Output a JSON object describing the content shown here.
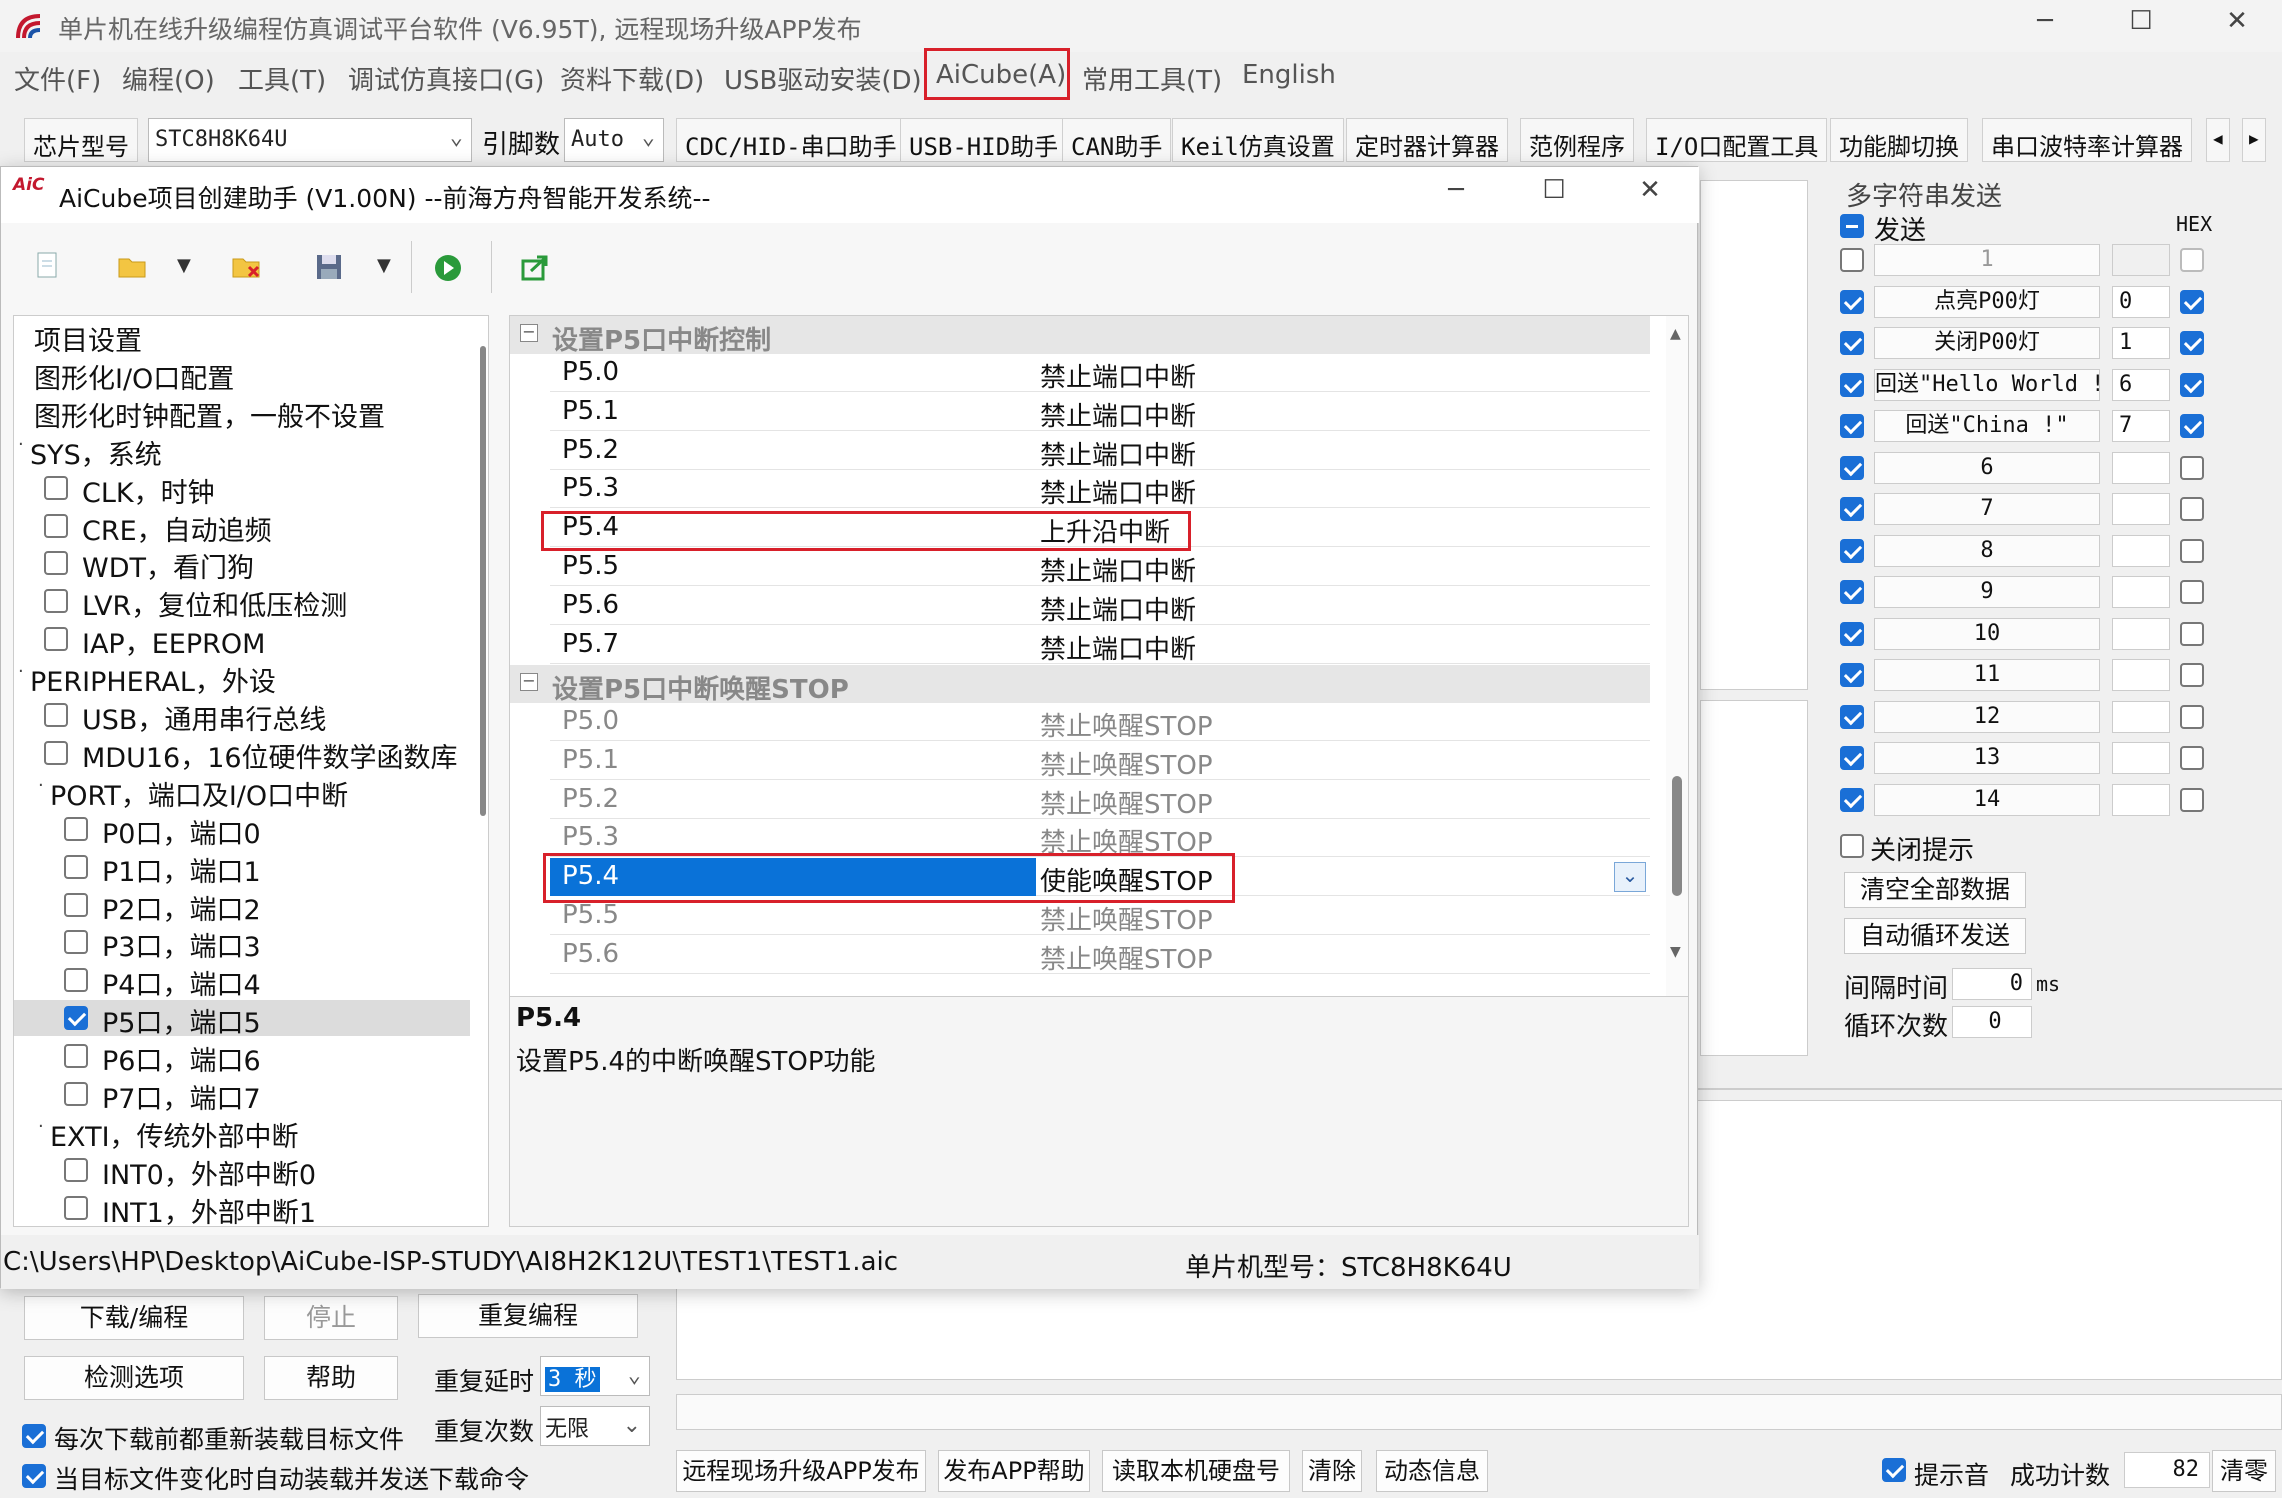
{
  "main_window": {
    "title": "单片机在线升级编程仿真调试平台软件 (V6.95T), 远程现场升级APP发布"
  },
  "menu": [
    "文件(F)",
    "编程(O)",
    "工具(T)",
    "调试仿真接口(G)",
    "资料下载(D)",
    "USB驱动安装(D)",
    "AiCube(A)",
    "常用工具(T)",
    "English"
  ],
  "toolbar": {
    "chip_label": "芯片型号",
    "chip_value": "STC8H8K64U",
    "pins_label": "引脚数",
    "pins_value": "Auto",
    "tabs": [
      "CDC/HID-串口助手",
      "USB-HID助手",
      "CAN助手",
      "Keil仿真设置",
      "定时器计算器",
      "范例程序",
      "I/O口配置工具",
      "功能脚切换",
      "串口波特率计算器"
    ],
    "scroll_left": "◀",
    "scroll_right": "▶"
  },
  "right_panel": {
    "group_title": "多字符串发送",
    "send_label": "发送",
    "hex_label": "HEX",
    "rows": [
      {
        "checked": false,
        "label": "1",
        "hex_value": "",
        "hex": false
      },
      {
        "checked": true,
        "label": "点亮P00灯",
        "hex_value": "0",
        "hex": true
      },
      {
        "checked": true,
        "label": "关闭P00灯",
        "hex_value": "1",
        "hex": true
      },
      {
        "checked": true,
        "label": "回送\"Hello World !\"",
        "hex_value": "6",
        "hex": true
      },
      {
        "checked": true,
        "label": "回送\"China !\"",
        "hex_value": "7",
        "hex": true
      },
      {
        "checked": true,
        "label": "6",
        "hex_value": "",
        "hex": false
      },
      {
        "checked": true,
        "label": "7",
        "hex_value": "",
        "hex": false
      },
      {
        "checked": true,
        "label": "8",
        "hex_value": "",
        "hex": false
      },
      {
        "checked": true,
        "label": "9",
        "hex_value": "",
        "hex": false
      },
      {
        "checked": true,
        "label": "10",
        "hex_value": "",
        "hex": false
      },
      {
        "checked": true,
        "label": "11",
        "hex_value": "",
        "hex": false
      },
      {
        "checked": true,
        "label": "12",
        "hex_value": "",
        "hex": false
      },
      {
        "checked": true,
        "label": "13",
        "hex_value": "",
        "hex": false
      },
      {
        "checked": true,
        "label": "14",
        "hex_value": "",
        "hex": false
      }
    ],
    "close_tip": "关闭提示",
    "clear_all": "清空全部数据",
    "auto_loop": "自动循环发送",
    "interval_label": "间隔时间",
    "interval_value": "0",
    "interval_unit": "ms",
    "loop_label": "循环次数",
    "loop_value": "0"
  },
  "bottom": {
    "download": "下载/编程",
    "stop": "停止",
    "reprogram": "重复编程",
    "detect": "检测选项",
    "help": "帮助",
    "repeat_delay_label": "重复延时",
    "repeat_delay_value": "3 秒",
    "repeat_count_label": "重复次数",
    "repeat_count_value": "无限",
    "reload_each": "每次下载前都重新装载目标文件",
    "reload_change": "当目标文件变化时自动装载并发送下载命令",
    "publish_app": "远程现场升级APP发布",
    "publish_help": "发布APP帮助",
    "read_disk": "读取本机硬盘号",
    "clear": "清除",
    "dynamic": "动态信息",
    "beep": "提示音",
    "success_label": "成功计数",
    "success_value": "82",
    "reset": "清零"
  },
  "dialog": {
    "title": "AiCube项目创建助手 (V1.00N) --前海方舟智能开发系统--",
    "logo_text": "AiC",
    "tree": [
      {
        "label": "项目设置",
        "level": 0,
        "check": null,
        "bullet": false
      },
      {
        "label": "图形化I/O口配置",
        "level": 0,
        "check": null,
        "bullet": false
      },
      {
        "label": "图形化时钟配置，一般不设置",
        "level": 0,
        "check": null,
        "bullet": false
      },
      {
        "label": "SYS，系统",
        "level": 0,
        "check": null,
        "bullet": true
      },
      {
        "label": "CLK，时钟",
        "level": 1,
        "check": false,
        "bullet": false
      },
      {
        "label": "CRE，自动追频",
        "level": 1,
        "check": false,
        "bullet": false
      },
      {
        "label": "WDT，看门狗",
        "level": 1,
        "check": false,
        "bullet": false
      },
      {
        "label": "LVR，复位和低压检测",
        "level": 1,
        "check": false,
        "bullet": false
      },
      {
        "label": "IAP，EEPROM",
        "level": 1,
        "check": false,
        "bullet": false
      },
      {
        "label": "PERIPHERAL，外设",
        "level": 0,
        "check": null,
        "bullet": true
      },
      {
        "label": "USB，通用串行总线",
        "level": 1,
        "check": false,
        "bullet": false
      },
      {
        "label": "MDU16，16位硬件数学函数库",
        "level": 1,
        "check": false,
        "bullet": false
      },
      {
        "label": "PORT，端口及I/O口中断",
        "level": 1,
        "check": null,
        "bullet": true
      },
      {
        "label": "P0口，端口0",
        "level": 2,
        "check": false,
        "bullet": false
      },
      {
        "label": "P1口，端口1",
        "level": 2,
        "check": false,
        "bullet": false
      },
      {
        "label": "P2口，端口2",
        "level": 2,
        "check": false,
        "bullet": false
      },
      {
        "label": "P3口，端口3",
        "level": 2,
        "check": false,
        "bullet": false
      },
      {
        "label": "P4口，端口4",
        "level": 2,
        "check": false,
        "bullet": false
      },
      {
        "label": "P5口，端口5",
        "level": 2,
        "check": true,
        "bullet": false,
        "selected": true
      },
      {
        "label": "P6口，端口6",
        "level": 2,
        "check": false,
        "bullet": false
      },
      {
        "label": "P7口，端口7",
        "level": 2,
        "check": false,
        "bullet": false
      },
      {
        "label": "EXTI，传统外部中断",
        "level": 1,
        "check": null,
        "bullet": true
      },
      {
        "label": "INT0，外部中断0",
        "level": 2,
        "check": false,
        "bullet": false
      },
      {
        "label": "INT1，外部中断1",
        "level": 2,
        "check": false,
        "bullet": false
      }
    ],
    "cat1": "设置P5口中断控制",
    "cat1_rows": [
      {
        "k": "P5.0",
        "v": "禁止端口中断"
      },
      {
        "k": "P5.1",
        "v": "禁止端口中断"
      },
      {
        "k": "P5.2",
        "v": "禁止端口中断"
      },
      {
        "k": "P5.3",
        "v": "禁止端口中断"
      },
      {
        "k": "P5.4",
        "v": "上升沿中断"
      },
      {
        "k": "P5.5",
        "v": "禁止端口中断"
      },
      {
        "k": "P5.6",
        "v": "禁止端口中断"
      },
      {
        "k": "P5.7",
        "v": "禁止端口中断"
      }
    ],
    "cat2": "设置P5口中断唤醒STOP",
    "cat2_rows": [
      {
        "k": "P5.0",
        "v": "禁止唤醒STOP"
      },
      {
        "k": "P5.1",
        "v": "禁止唤醒STOP"
      },
      {
        "k": "P5.2",
        "v": "禁止唤醒STOP"
      },
      {
        "k": "P5.3",
        "v": "禁止唤醒STOP"
      },
      {
        "k": "P5.4",
        "v": "使能唤醒STOP"
      },
      {
        "k": "P5.5",
        "v": "禁止唤醒STOP"
      },
      {
        "k": "P5.6",
        "v": "禁止唤醒STOP"
      }
    ],
    "desc_title": "P5.4",
    "desc_text": "设置P5.4的中断唤醒STOP功能",
    "path": "C:\\Users\\HP\\Desktop\\AiCube-ISP-STUDY\\AI8H2K12U\\TEST1\\TEST1.aic",
    "chip_status": "单片机型号：STC8H8K64U"
  },
  "colors": {
    "accent": "#1a6fd6",
    "highlight_border": "#d8202a",
    "selection": "#0a72d8"
  }
}
